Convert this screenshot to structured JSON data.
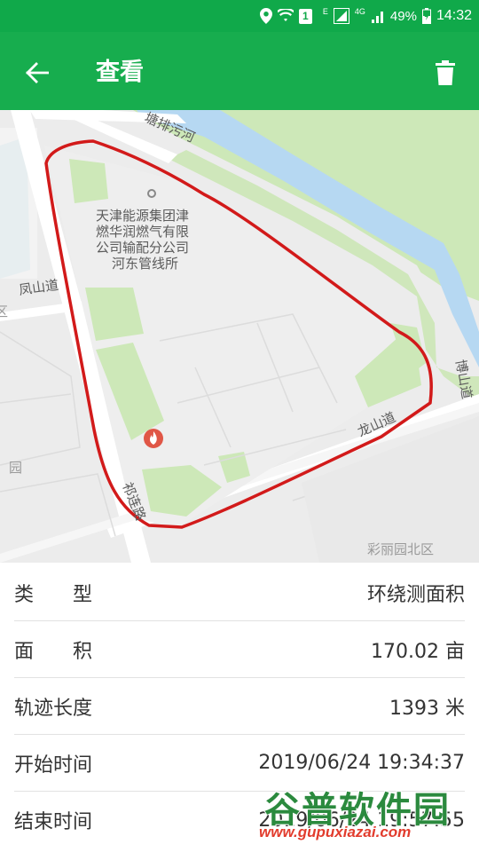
{
  "status_bar": {
    "battery": "49%",
    "time": "14:32",
    "sim_label": "1",
    "net_e": "E",
    "net_4g": "4G"
  },
  "app_bar": {
    "title": "查看",
    "back_icon": "arrow-left-icon",
    "delete_icon": "trash-icon"
  },
  "map": {
    "labels": {
      "canal": "塘排污河",
      "poi": [
        "天津能源集团津",
        "燃华润燃气有限",
        "公司输配分公司",
        "河东管线所"
      ],
      "fengshan_road": "凤山道",
      "longshan_road": "龙山道",
      "boshan_road": "博山道",
      "qilian_road": "祁连路",
      "caili_north": "彩丽园北区",
      "yuan": "园",
      "left_edge": "区"
    },
    "track_color": "#d21a1a"
  },
  "details": {
    "rows": [
      {
        "label": "类　　型",
        "value": "环绕测面积"
      },
      {
        "label": "面　　积",
        "value": "170.02 亩"
      },
      {
        "label": "轨迹长度",
        "value": "1393 米"
      },
      {
        "label": "开始时间",
        "value": "2019/06/24 19:34:37"
      },
      {
        "label": "结束时间",
        "value": "2019/06/24 19:57:55"
      }
    ]
  },
  "watermark": {
    "name": "谷普软件园",
    "url": "www.gupuxiazai.com"
  }
}
